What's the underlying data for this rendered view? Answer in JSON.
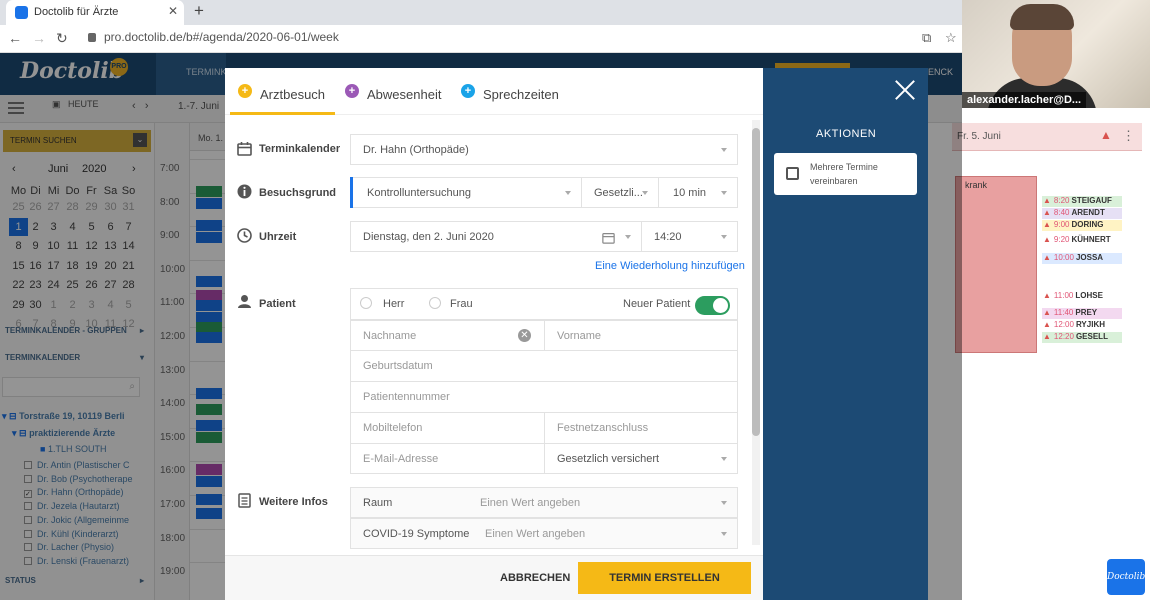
{
  "browser": {
    "tab_title": "Doctolib für Ärzte",
    "url": "pro.doctolib.de/b#/agenda/2020-06-01/week"
  },
  "webcam": {
    "label": "alexander.lacher@D..."
  },
  "app": {
    "logo": "Doctolib",
    "pro_badge": "PRO",
    "header_btn": "TERMINK",
    "header_right": "ENCK",
    "today_btn": "HEUTE",
    "week_range": "1.-7. Juni",
    "day_col": "Mo. 1."
  },
  "sidebar": {
    "search_btn": "TERMIN SUCHEN",
    "month": "Juni",
    "year": "2020",
    "weekdays": [
      "Mo",
      "Di",
      "Mi",
      "Do",
      "Fr",
      "Sa",
      "So"
    ],
    "weeks": [
      [
        "25",
        "26",
        "27",
        "28",
        "29",
        "30",
        "31"
      ],
      [
        "1",
        "2",
        "3",
        "4",
        "5",
        "6",
        "7"
      ],
      [
        "8",
        "9",
        "10",
        "11",
        "12",
        "13",
        "14"
      ],
      [
        "15",
        "16",
        "17",
        "18",
        "19",
        "20",
        "21"
      ],
      [
        "22",
        "23",
        "24",
        "25",
        "26",
        "27",
        "28"
      ],
      [
        "29",
        "30",
        "1",
        "2",
        "3",
        "4",
        "5"
      ],
      [
        "6",
        "7",
        "8",
        "9",
        "10",
        "11",
        "12"
      ]
    ],
    "groups_hdr": "TERMINKALENDER - GRUPPEN",
    "cal_hdr": "TERMINKALENDER",
    "address": "Torstraße 19, 10119 Berli",
    "practice": "praktizierende Ärzte",
    "room": "1.TLH SOUTH",
    "doctors": [
      "Dr. Antin (Plastischer C",
      "Dr. Bob (Psychotherape",
      "Dr. Hahn (Orthopäde)",
      "Dr. Jezela (Hautarzt)",
      "Dr. Jokic (Allgemeinme",
      "Dr. Kühl (Kinderarzt)",
      "Dr. Lacher (Physio)",
      "Dr. Lenski (Frauenarzt)"
    ],
    "status": "STATUS"
  },
  "grid": {
    "times": [
      "7:00",
      "8:00",
      "9:00",
      "10:00",
      "11:00",
      "12:00",
      "13:00",
      "14:00",
      "15:00",
      "16:00",
      "17:00",
      "18:00",
      "19:00"
    ],
    "right_day": "Fr. 5. Juni",
    "krank": "krank",
    "right_entries": [
      {
        "time": "8:20",
        "name": "STEIGAUF"
      },
      {
        "time": "8:40",
        "name": "ARENDT"
      },
      {
        "time": "9:00",
        "name": "DORING"
      },
      {
        "time": "9:20",
        "name": "KÜHNERT"
      },
      {
        "time": "10:00",
        "name": "JOSSA"
      },
      {
        "time": "11:00",
        "name": "LOHSE"
      },
      {
        "time": "11:40",
        "name": "PREY"
      },
      {
        "time": "12:00",
        "name": "RYJIKH"
      },
      {
        "time": "12:20",
        "name": "GESELL"
      }
    ]
  },
  "modal": {
    "tabs": [
      {
        "label": "Arztbesuch",
        "color": "#f5b916"
      },
      {
        "label": "Abwesenheit",
        "color": "#9b59b6"
      },
      {
        "label": "Sprechzeiten",
        "color": "#1aa3e8"
      }
    ],
    "labels": {
      "terminkalender": "Terminkalender",
      "besuchsgrund": "Besuchsgrund",
      "uhrzeit": "Uhrzeit",
      "patient": "Patient",
      "weitere": "Weitere Infos"
    },
    "terminkalender_value": "Dr. Hahn (Orthopäde)",
    "besuchsgrund_value": "Kontrolluntersuchung",
    "versicherung_value": "Gesetzli...",
    "duration_value": "10 min",
    "date_value": "Dienstag, den 2. Juni 2020",
    "time_value": "14:20",
    "wiederholung_link": "Eine Wiederholung hinzufügen",
    "herr": "Herr",
    "frau": "Frau",
    "neuer_patient": "Neuer Patient",
    "placeholders": {
      "nachname": "Nachname",
      "vorname": "Vorname",
      "geburtsdatum": "Geburtsdatum",
      "patientennummer": "Patientennummer",
      "mobil": "Mobiltelefon",
      "festnetz": "Festnetzanschluss",
      "email": "E-Mail-Adresse"
    },
    "versicherung_select": "Gesetzlich versichert",
    "raum_label": "Raum",
    "raum_value": "Einen Wert angeben",
    "covid_label": "COVID-19 Symptome",
    "covid_value": "Einen Wert angeben",
    "cancel": "ABBRECHEN",
    "submit": "TERMIN ERSTELLEN"
  },
  "aktionen": {
    "title": "AKTIONEN",
    "mehrere": "Mehrere Termine vereinbaren"
  }
}
